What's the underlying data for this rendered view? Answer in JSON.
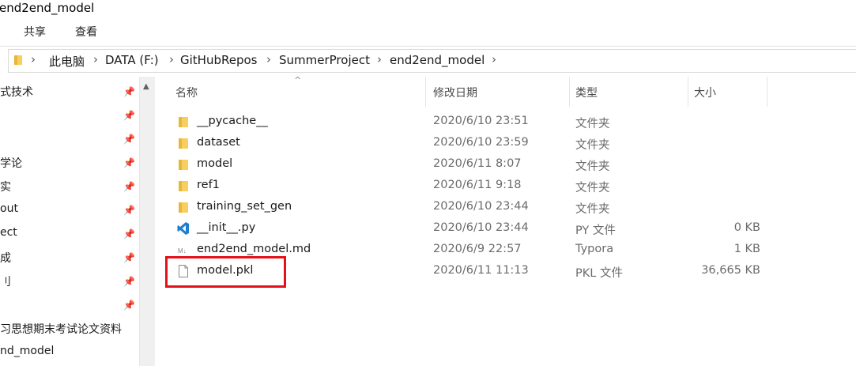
{
  "window": {
    "title": "end2end_model"
  },
  "ribbon": {
    "tabs": [
      "共享",
      "查看"
    ]
  },
  "address": {
    "crumbs": [
      "此电脑",
      "DATA (F:)",
      "GitHubRepos",
      "SummerProject",
      "end2end_model"
    ],
    "separator": "›"
  },
  "nav": {
    "items": [
      {
        "label": "式技术",
        "pinned": true
      },
      {
        "label": "",
        "pinned": true
      },
      {
        "label": "",
        "pinned": true
      },
      {
        "label": "学论",
        "pinned": true
      },
      {
        "label": "实",
        "pinned": true
      },
      {
        "label": "out",
        "pinned": true
      },
      {
        "label": "ect",
        "pinned": true
      },
      {
        "label": "成",
        "pinned": true
      },
      {
        "label": "刂",
        "pinned": true
      },
      {
        "label": "",
        "pinned": true
      },
      {
        "label": "习思想期末考试论文资料",
        "pinned": false
      },
      {
        "label": "nd_model",
        "pinned": false
      }
    ]
  },
  "columns": {
    "name": "名称",
    "date": "修改日期",
    "type": "类型",
    "size": "大小"
  },
  "files": [
    {
      "name": "__pycache__",
      "date": "2020/6/10 23:51",
      "type": "文件夹",
      "size": "",
      "icon": "folder-icon"
    },
    {
      "name": "dataset",
      "date": "2020/6/10 23:59",
      "type": "文件夹",
      "size": "",
      "icon": "folder-icon"
    },
    {
      "name": "model",
      "date": "2020/6/11 8:07",
      "type": "文件夹",
      "size": "",
      "icon": "folder-icon"
    },
    {
      "name": "ref1",
      "date": "2020/6/11 9:18",
      "type": "文件夹",
      "size": "",
      "icon": "folder-icon"
    },
    {
      "name": "training_set_gen",
      "date": "2020/6/10 23:44",
      "type": "文件夹",
      "size": "",
      "icon": "folder-icon"
    },
    {
      "name": "__init__.py",
      "date": "2020/6/10 23:44",
      "type": "PY 文件",
      "size": "0 KB",
      "icon": "vscode-icon"
    },
    {
      "name": "end2end_model.md",
      "date": "2020/6/9 22:57",
      "type": "Typora",
      "size": "1 KB",
      "icon": "markdown-icon"
    },
    {
      "name": "model.pkl",
      "date": "2020/6/11 11:13",
      "type": "PKL 文件",
      "size": "36,665 KB",
      "icon": "file-icon"
    }
  ],
  "colors": {
    "highlight": "#e3121a",
    "folder": "#f3c34a",
    "vscode": "#1e7fd0"
  }
}
